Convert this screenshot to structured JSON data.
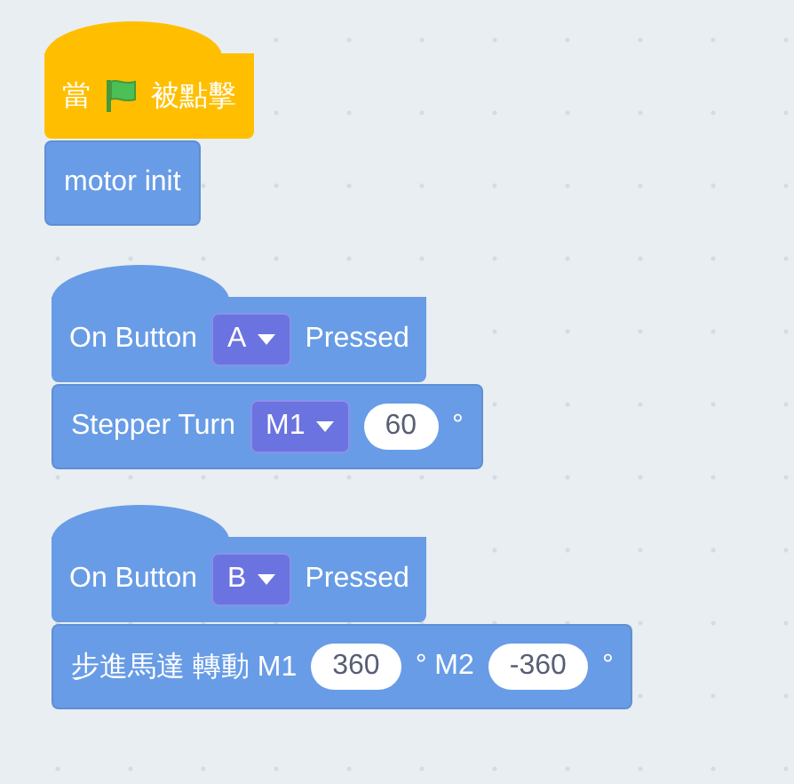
{
  "scripts": [
    {
      "blocks": [
        {
          "kind": "hat",
          "color": "#ffbf00",
          "parts": [
            {
              "kind": "text",
              "text": "當"
            },
            {
              "kind": "flag"
            },
            {
              "kind": "text",
              "text": "被點擊"
            }
          ]
        },
        {
          "kind": "stack",
          "color": "#689ce6",
          "parts": [
            {
              "kind": "text",
              "text": "motor init"
            }
          ]
        }
      ]
    },
    {
      "blocks": [
        {
          "kind": "hat",
          "color": "#689ce6",
          "parts": [
            {
              "kind": "text",
              "text": "On Button"
            },
            {
              "kind": "dropdown",
              "text": "A"
            },
            {
              "kind": "text",
              "text": "Pressed"
            }
          ]
        },
        {
          "kind": "stack",
          "color": "#689ce6",
          "parts": [
            {
              "kind": "text",
              "text": "Stepper Turn"
            },
            {
              "kind": "dropdown",
              "text": "M1"
            },
            {
              "kind": "number",
              "text": "60"
            },
            {
              "kind": "text",
              "text": "°"
            }
          ]
        }
      ]
    },
    {
      "blocks": [
        {
          "kind": "hat",
          "color": "#689ce6",
          "parts": [
            {
              "kind": "text",
              "text": "On Button"
            },
            {
              "kind": "dropdown",
              "text": "B"
            },
            {
              "kind": "text",
              "text": "Pressed"
            }
          ]
        },
        {
          "kind": "stack",
          "color": "#689ce6",
          "parts": [
            {
              "kind": "text",
              "text": "步進馬達 轉動 M1"
            },
            {
              "kind": "number",
              "text": "360"
            },
            {
              "kind": "text",
              "text": "° M2"
            },
            {
              "kind": "number",
              "text": "-360"
            },
            {
              "kind": "text",
              "text": "°"
            }
          ]
        }
      ]
    }
  ]
}
